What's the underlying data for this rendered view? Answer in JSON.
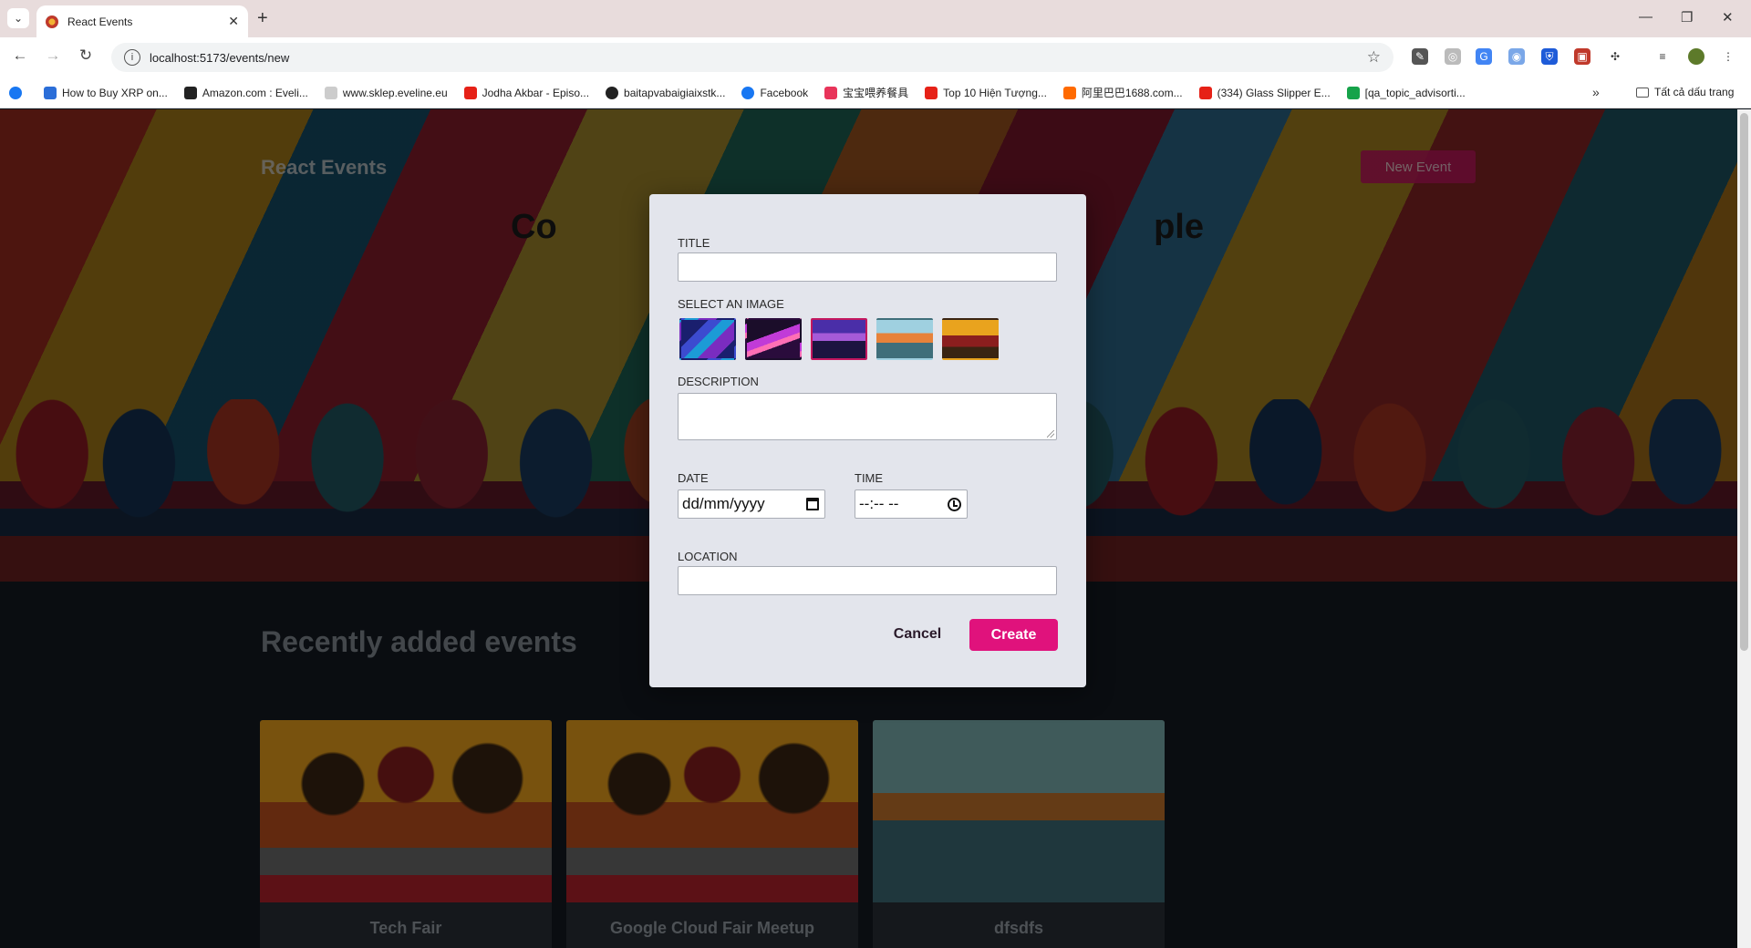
{
  "browser": {
    "tab_title": "React Events",
    "url": "localhost:5173/events/new",
    "bookmarks": [
      {
        "label": "",
        "color": "#1877f2"
      },
      {
        "label": "How to Buy XRP on...",
        "color": "#2b6ed8"
      },
      {
        "label": "Amazon.com : Eveli...",
        "color": "#222222"
      },
      {
        "label": "www.sklep.eveline.eu",
        "color": "#999999"
      },
      {
        "label": "Jodha Akbar - Episo...",
        "color": "#e62117"
      },
      {
        "label": "baitapvabaigiaixstk...",
        "color": "#222222"
      },
      {
        "label": "Facebook",
        "color": "#1877f2"
      },
      {
        "label": "宝宝喂养餐具",
        "color": "#e8345a"
      },
      {
        "label": "Top 10 Hiện Tượng...",
        "color": "#e62117"
      },
      {
        "label": "阿里巴巴1688.com...",
        "color": "#ff6a00"
      },
      {
        "label": "(334) Glass Slipper E...",
        "color": "#e62117"
      },
      {
        "label": "[qa_topic_advisorti...",
        "color": "#16a34a"
      }
    ],
    "all_bookmarks_label": "Tất cả dấu trang"
  },
  "page": {
    "brand": "React Events",
    "new_event_label": "New Event",
    "hero_heading_left": "Co",
    "hero_heading_right": "ple",
    "recent_title": "Recently added events",
    "cards": [
      {
        "title": "Tech Fair",
        "image": "friends-laptop"
      },
      {
        "title": "Google Cloud Fair Meetup",
        "image": "friends-laptop"
      },
      {
        "title": "dfsdfs",
        "image": "autumn-park-city"
      }
    ]
  },
  "modal": {
    "title_label": "TITLE",
    "title_value": "",
    "image_label": "SELECT AN IMAGE",
    "images": [
      {
        "name": "neon-city",
        "selected": false
      },
      {
        "name": "concert-stage",
        "selected": false
      },
      {
        "name": "purple-party",
        "selected": true
      },
      {
        "name": "city-park",
        "selected": false
      },
      {
        "name": "friends-laptop",
        "selected": false
      }
    ],
    "description_label": "DESCRIPTION",
    "description_value": "",
    "date_label": "DATE",
    "date_placeholder": "dd/mm/yyyy",
    "time_label": "TIME",
    "time_placeholder": "--:-- --",
    "location_label": "LOCATION",
    "location_value": "",
    "cancel_label": "Cancel",
    "create_label": "Create",
    "accent_color": "#e0127c"
  }
}
